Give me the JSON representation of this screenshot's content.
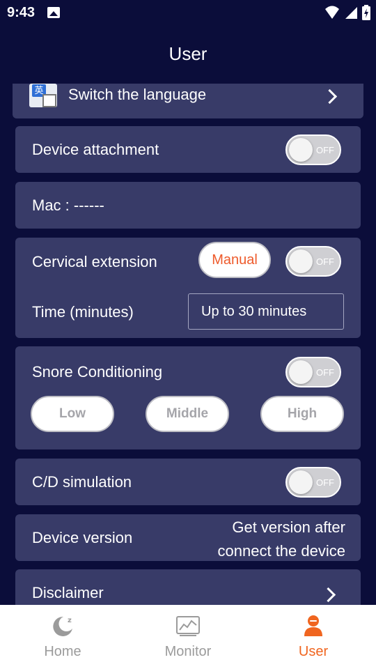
{
  "status_bar": {
    "time": "9:43"
  },
  "header": {
    "title": "User"
  },
  "settings": {
    "language": {
      "label": "Switch the language",
      "icon_char": "英"
    },
    "device_attachment": {
      "label": "Device attachment",
      "toggle_text": "OFF",
      "enabled": false
    },
    "mac": {
      "label": "Mac : ------"
    },
    "cervical_extension": {
      "label": "Cervical extension",
      "mode_label": "Manual",
      "toggle_text": "OFF",
      "enabled": false,
      "time_label": "Time (minutes)",
      "time_value": "Up to 30 minutes"
    },
    "snore_conditioning": {
      "label": "Snore Conditioning",
      "toggle_text": "OFF",
      "enabled": false,
      "levels": [
        "Low",
        "Middle",
        "High"
      ]
    },
    "cd_simulation": {
      "label": "C/D simulation",
      "toggle_text": "OFF",
      "enabled": false
    },
    "device_version": {
      "label": "Device version",
      "value_line1": "Get version after",
      "value_line2": "connect the device"
    },
    "disclaimer": {
      "label": "Disclaimer"
    }
  },
  "bottom_nav": {
    "items": [
      {
        "label": "Home",
        "icon": "moon-sleep-icon",
        "active": false
      },
      {
        "label": "Monitor",
        "icon": "monitor-chart-icon",
        "active": false
      },
      {
        "label": "User",
        "icon": "user-icon",
        "active": true
      }
    ]
  },
  "colors": {
    "background": "#0b0d3a",
    "card": "#383b68",
    "accent": "#f0651f",
    "inactive_nav": "#9b9b9b"
  }
}
